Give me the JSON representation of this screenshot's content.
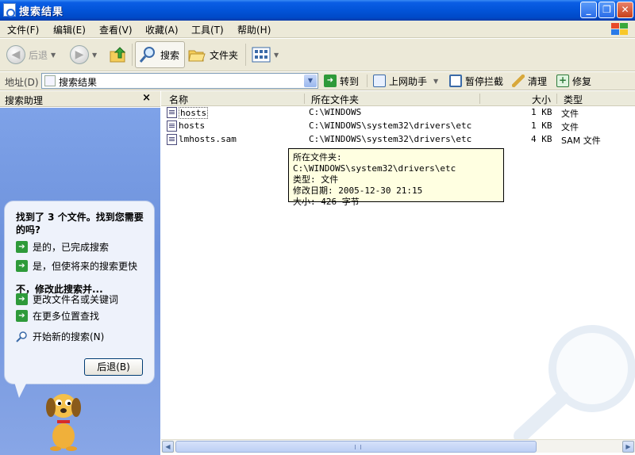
{
  "window": {
    "title": "搜索结果"
  },
  "menu": [
    "文件(F)",
    "编辑(E)",
    "查看(V)",
    "收藏(A)",
    "工具(T)",
    "帮助(H)"
  ],
  "toolbar": {
    "back_label": "后退",
    "search_label": "搜索",
    "folders_label": "文件夹"
  },
  "address": {
    "label": "地址(D)",
    "value": "搜索结果",
    "go_label": "转到",
    "web_assistant_label": "上网助手",
    "popup_block_label": "暂停拦截",
    "clean_label": "清理",
    "repair_label": "修复"
  },
  "left_pane": {
    "header": "搜索助理",
    "close_glyph": "×",
    "question": "找到了 3 个文件。找到您需要的吗?",
    "options_yes": [
      "是的，已完成搜索",
      "是，但使将来的搜索更快"
    ],
    "subheading": "不，修改此搜索并...",
    "options_no": [
      "更改文件名或关键词",
      "在更多位置查找"
    ],
    "new_search": "开始新的搜索(N)",
    "back_button": "后退(B)"
  },
  "columns": [
    "名称",
    "所在文件夹",
    "大小",
    "类型"
  ],
  "files": [
    {
      "name": "hosts",
      "folder": "C:\\WINDOWS",
      "size": "1 KB",
      "type": "文件"
    },
    {
      "name": "hosts",
      "folder": "C:\\WINDOWS\\system32\\drivers\\etc",
      "size": "1 KB",
      "type": "文件"
    },
    {
      "name": "lmhosts.sam",
      "folder": "C:\\WINDOWS\\system32\\drivers\\etc",
      "size": "4 KB",
      "type": "SAM 文件"
    }
  ],
  "tooltip": [
    "所在文件夹: C:\\WINDOWS\\system32\\drivers\\etc",
    "类型: 文件",
    "修改日期: 2005-12-30 21:15",
    "大小: 426 字节"
  ],
  "colors": {
    "titlebar": "#0254d8",
    "chrome": "#ece9d8",
    "task_pane": "#7ea2e8",
    "tooltip": "#ffffe1"
  }
}
